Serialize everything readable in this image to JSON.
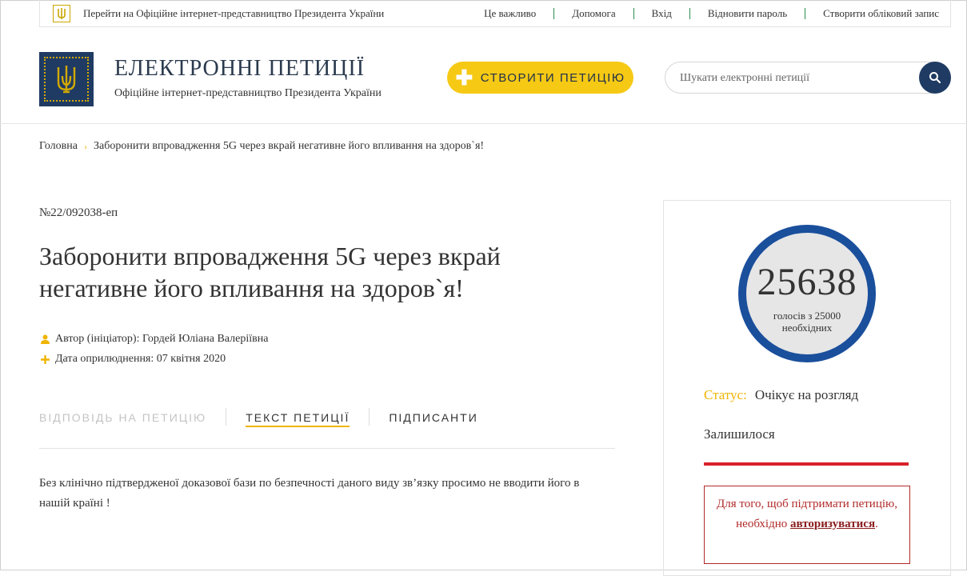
{
  "topbar": {
    "president_link": "Перейти на Офіційне інтернет-представництво Президента України",
    "links": [
      "Це важливо",
      "Допомога",
      "Вхід",
      "Відновити пароль",
      "Створити обліковий запис"
    ]
  },
  "header": {
    "title": "ЕЛЕКТРОННІ ПЕТИЦІЇ",
    "subtitle": "Офіційне інтернет-представництво Президента України",
    "create_button": "СТВОРИТИ ПЕТИЦІЮ",
    "search_placeholder": "Шукати електронні петиції"
  },
  "breadcrumb": {
    "home": "Головна",
    "current": "Заборонити впровадження 5G через вкрай негативне його впливання на здоров`я!"
  },
  "petition": {
    "number": "№22/092038-еп",
    "title": "Заборонити впровадження 5G через вкрай негативне його впливання на здоров`я!",
    "author": "Автор (ініціатор): Гордей Юліана Валеріївна",
    "date": "Дата оприлюднення: 07 квітня 2020",
    "tabs": [
      "ВІДПОВІДЬ НА ПЕТИЦІЮ",
      "ТЕКСТ ПЕТИЦІЇ",
      "ПІДПИСАНТИ"
    ],
    "text": "Без клінічно підтвердженої доказової бази по безпечності даного виду зв’язку просимо не вводити його в нашій країні !"
  },
  "sidebar": {
    "votes": "25638",
    "votes_label": "голосів з 25000 необхідних",
    "status_label": "Статус:",
    "status_value": "Очікує на розгляд",
    "remaining": "Залишилося",
    "auth_text_1": "Для того, щоб підтримати петицію, необхідно",
    "auth_link": "авторизуватися",
    "auth_text_2": "."
  },
  "colors": {
    "navy": "#1f3b63",
    "yellow": "#f6c915",
    "accent_gold": "#f0b400",
    "counter_ring": "#1a4f9c",
    "red": "#d9202a"
  }
}
